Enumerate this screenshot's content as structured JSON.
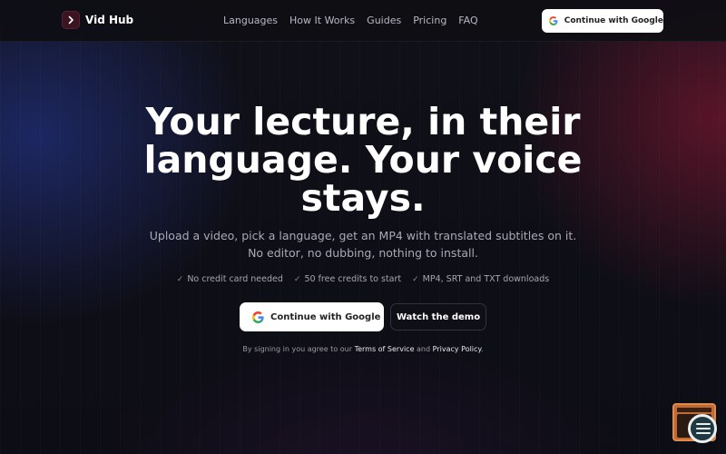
{
  "brand": {
    "name": "Vid Hub"
  },
  "nav": {
    "links": [
      "Languages",
      "How It Works",
      "Guides",
      "Pricing",
      "FAQ"
    ],
    "cta_label": "Continue with Google"
  },
  "hero": {
    "title_lines": [
      "Your lecture, in their",
      "language. Your voice",
      "stays."
    ],
    "subtitle": "Upload a video, pick a language, get an MP4 with translated subtitles on it. No editor, no dubbing, nothing to install.",
    "features": [
      "No credit card needed",
      "50 free credits to start",
      "MP4, SRT and TXT downloads"
    ],
    "primary_cta": "Continue with Google",
    "secondary_cta": "Watch the demo"
  },
  "terms": {
    "prefix": "By signing in you agree to our",
    "tos": "Terms of Service",
    "and": "and",
    "privacy": "Privacy Policy",
    "suffix": "."
  },
  "icons": {
    "logo": "play-chevron-icon",
    "google": "google-g-icon",
    "check": "check-icon",
    "widget": "inspector-widget-icon"
  },
  "colors": {
    "background": "#0b0b12",
    "accent_blue_glow": "#283ca0",
    "accent_red_glow": "#961937",
    "button_bg": "#ffffff"
  }
}
